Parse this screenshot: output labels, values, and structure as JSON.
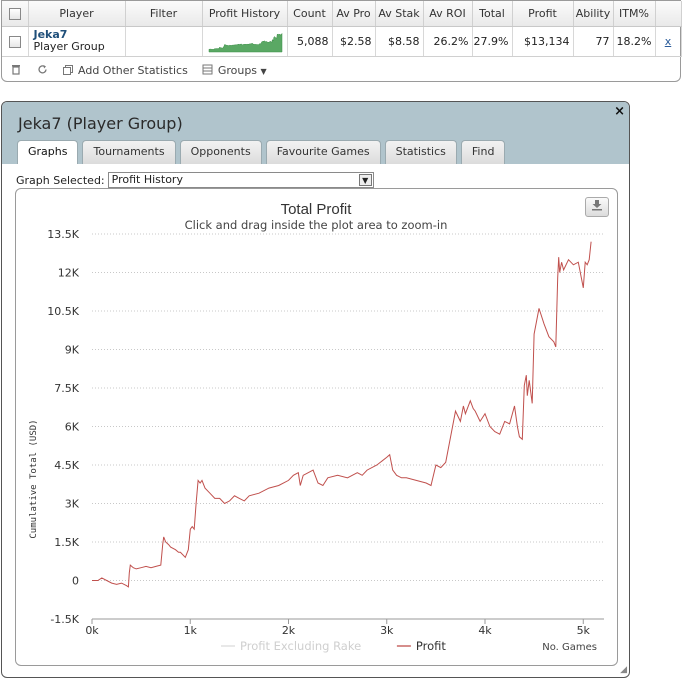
{
  "stats": {
    "columns": [
      "",
      "Player",
      "Filter",
      "Profit History",
      "Count",
      "Av Pro",
      "Av Stak",
      "Av ROI",
      "Total",
      "Profit",
      "Ability",
      "ITM%",
      ""
    ],
    "row": {
      "player_name": "Jeka7",
      "player_type": "Player Group",
      "filter": "",
      "count": "5,088",
      "av_profit": "$2.58",
      "av_stake": "$8.58",
      "av_roi": "26.2%",
      "total_roi": "27.9%",
      "profit": "$13,134",
      "ability": "77",
      "itm": "18.2%",
      "remove": "x"
    },
    "toolbar": {
      "delete_icon": "trash-icon",
      "refresh_icon": "refresh-icon",
      "add_stats_label": "Add Other Statistics",
      "groups_label": "Groups"
    }
  },
  "window": {
    "title": "Jeka7 (Player Group)",
    "close": "×",
    "tabs": [
      "Graphs",
      "Tournaments",
      "Opponents",
      "Favourite Games",
      "Statistics",
      "Find"
    ],
    "active_tab": "Graphs",
    "graph_selected_label": "Graph Selected:",
    "graph_selected_value": "Profit History"
  },
  "chart_data": {
    "type": "line",
    "title": "Total Profit",
    "subtitle": "Click and drag inside the plot area to zoom-in",
    "xlabel": "No. Games",
    "ylabel": "Cumulative Total (USD)",
    "x_ticks": [
      "0k",
      "1k",
      "2k",
      "3k",
      "4k",
      "5k"
    ],
    "y_ticks": [
      "-1.5K",
      "0",
      "1.5K",
      "3K",
      "4.5K",
      "6K",
      "7.5K",
      "9K",
      "10.5K",
      "12K",
      "13.5K"
    ],
    "xlim": [
      0,
      5150
    ],
    "ylim": [
      -1500,
      13500
    ],
    "grid": true,
    "legend_position": "bottom-center",
    "series": [
      {
        "name": "Profit Excluding Rake",
        "color": "#e2e2e2",
        "visible": false,
        "x": [],
        "y": []
      },
      {
        "name": "Profit",
        "color": "#c0504d",
        "visible": true,
        "x": [
          0,
          60,
          100,
          150,
          200,
          250,
          300,
          350,
          370,
          380,
          390,
          420,
          450,
          500,
          550,
          600,
          650,
          700,
          720,
          730,
          750,
          780,
          800,
          850,
          880,
          900,
          950,
          980,
          1000,
          1020,
          1040,
          1060,
          1080,
          1100,
          1120,
          1150,
          1200,
          1250,
          1300,
          1350,
          1400,
          1450,
          1500,
          1550,
          1600,
          1700,
          1800,
          1900,
          2000,
          2050,
          2100,
          2120,
          2150,
          2200,
          2250,
          2300,
          2350,
          2400,
          2500,
          2600,
          2700,
          2750,
          2800,
          2900,
          3000,
          3030,
          3060,
          3100,
          3150,
          3200,
          3300,
          3400,
          3450,
          3500,
          3550,
          3600,
          3700,
          3750,
          3780,
          3800,
          3850,
          3880,
          3900,
          3950,
          4000,
          4050,
          4100,
          4150,
          4200,
          4250,
          4300,
          4330,
          4350,
          4380,
          4400,
          4420,
          4430,
          4450,
          4480,
          4500,
          4550,
          4600,
          4650,
          4700,
          4720,
          4740,
          4750,
          4760,
          4780,
          4800,
          4850,
          4900,
          4950,
          4980,
          5000,
          5020,
          5040,
          5060,
          5080
        ],
        "y": [
          0,
          0,
          100,
          0,
          -100,
          -150,
          -100,
          -200,
          -250,
          300,
          600,
          500,
          450,
          500,
          550,
          500,
          550,
          600,
          1400,
          1700,
          1500,
          1400,
          1300,
          1200,
          1100,
          1100,
          900,
          1200,
          2000,
          2100,
          2000,
          3000,
          3900,
          3800,
          3900,
          3600,
          3400,
          3200,
          3200,
          3000,
          3100,
          3300,
          3200,
          3100,
          3300,
          3400,
          3600,
          3700,
          3900,
          4100,
          4200,
          3700,
          4100,
          4200,
          4300,
          3800,
          3700,
          4000,
          4100,
          4000,
          4200,
          4100,
          4300,
          4500,
          4800,
          4900,
          4300,
          4100,
          4000,
          4000,
          3900,
          3800,
          3700,
          4500,
          4400,
          4600,
          6600,
          6200,
          6800,
          6500,
          7000,
          6700,
          6600,
          6200,
          6500,
          6000,
          5800,
          5700,
          6200,
          6100,
          6800,
          6000,
          5600,
          5500,
          7600,
          8000,
          7200,
          7800,
          6900,
          9600,
          10600,
          10000,
          9500,
          9300,
          9100,
          11800,
          12600,
          12000,
          12400,
          12100,
          12500,
          12300,
          12400,
          11800,
          11400,
          12400,
          12300,
          12500,
          13200
        ]
      }
    ]
  }
}
